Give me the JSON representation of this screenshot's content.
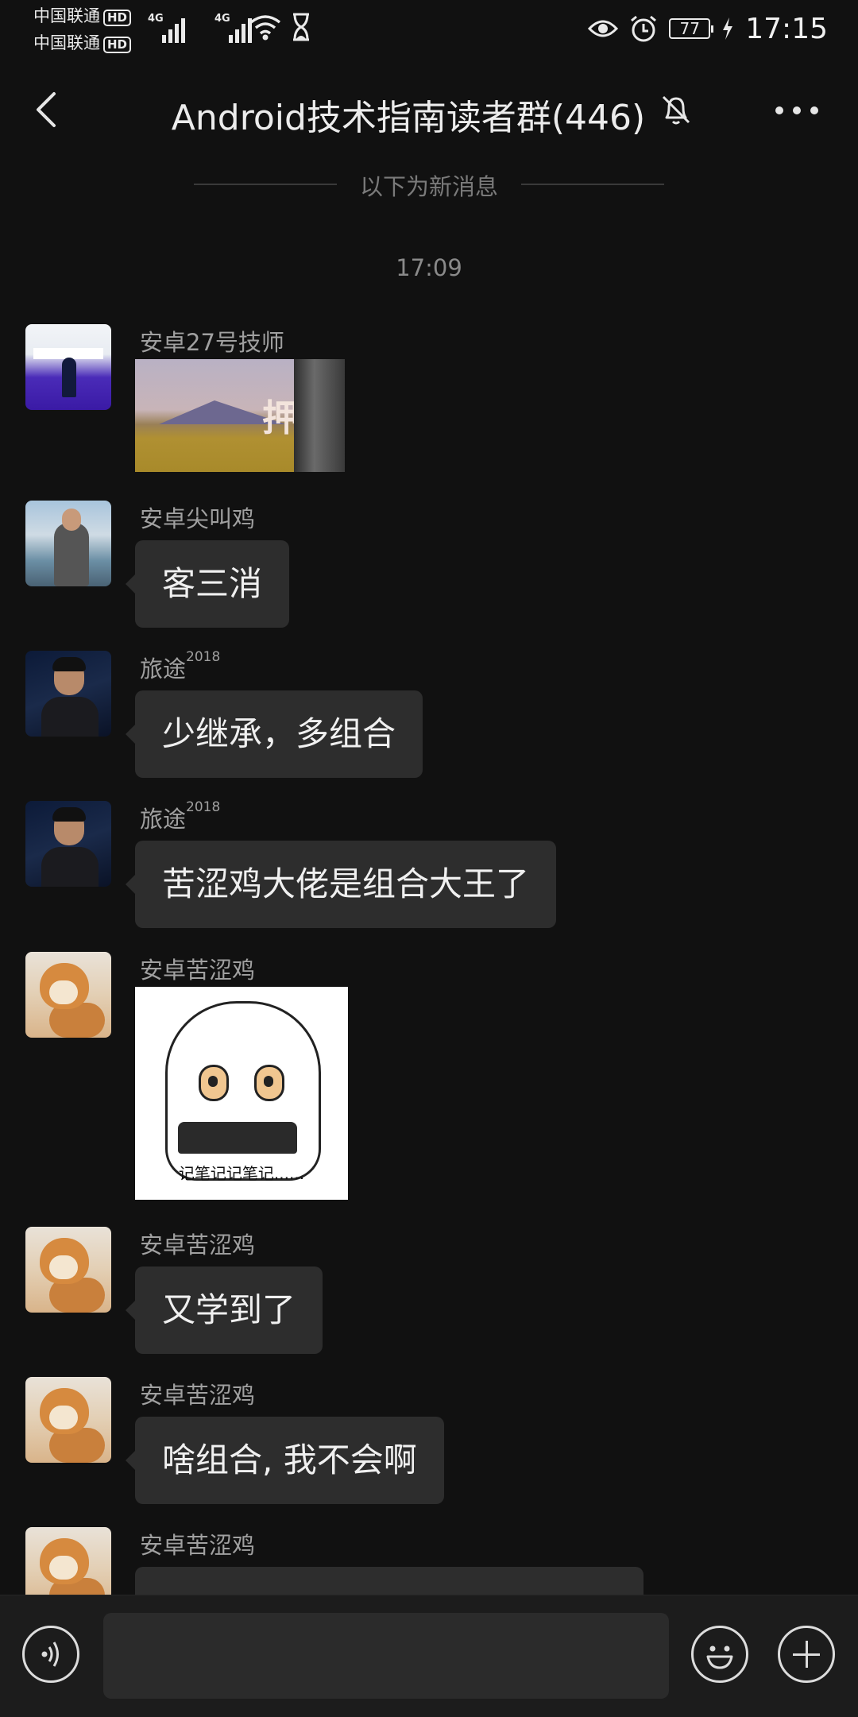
{
  "status_bar": {
    "carrier1": "中国联通",
    "carrier2": "中国联通",
    "hd_badge": "HD",
    "network_type": "4G",
    "battery_level": "77",
    "time": "17:15",
    "icons": [
      "signal-icon",
      "wifi-icon",
      "hourglass-icon",
      "eye-icon",
      "alarm-icon",
      "battery-icon",
      "charging-icon"
    ]
  },
  "header": {
    "title": "Android技术指南读者群(446)",
    "icons": [
      "back-icon",
      "mute-icon",
      "more-icon"
    ]
  },
  "separator": {
    "new_messages_label": "以下为新消息"
  },
  "timestamp": "17:09",
  "messages": [
    {
      "sender": "安卓27号技师",
      "type": "image",
      "avatar": "tech-avatar"
    },
    {
      "sender": "安卓尖叫鸡",
      "type": "text",
      "text": "客三消",
      "avatar": "scream-avatar"
    },
    {
      "sender": "旅途",
      "sender_sup": "2018",
      "type": "text",
      "text": "少继承，多组合",
      "avatar": "lutu-avatar"
    },
    {
      "sender": "旅途",
      "sender_sup": "2018",
      "type": "text",
      "text": "苦涩鸡大佬是组合大王了",
      "avatar": "lutu-avatar"
    },
    {
      "sender": "安卓苦涩鸡",
      "type": "sticker",
      "sticker_caption": "记笔记记笔记......",
      "avatar": "dog-avatar"
    },
    {
      "sender": "安卓苦涩鸡",
      "type": "text",
      "text": "又学到了",
      "avatar": "dog-avatar"
    },
    {
      "sender": "安卓苦涩鸡",
      "type": "text",
      "text": "啥组合, 我不会啊",
      "avatar": "dog-avatar"
    },
    {
      "sender": "安卓苦涩鸡",
      "type": "text",
      "text": "",
      "avatar": "dog-avatar"
    }
  ],
  "image_text": "押",
  "input_bar": {
    "value": "",
    "icons": [
      "voice-icon",
      "emoji-icon",
      "plus-icon"
    ]
  },
  "colors": {
    "background": "#111111",
    "bubble": "#2d2d2d",
    "input_bar": "#1c1c1c"
  }
}
